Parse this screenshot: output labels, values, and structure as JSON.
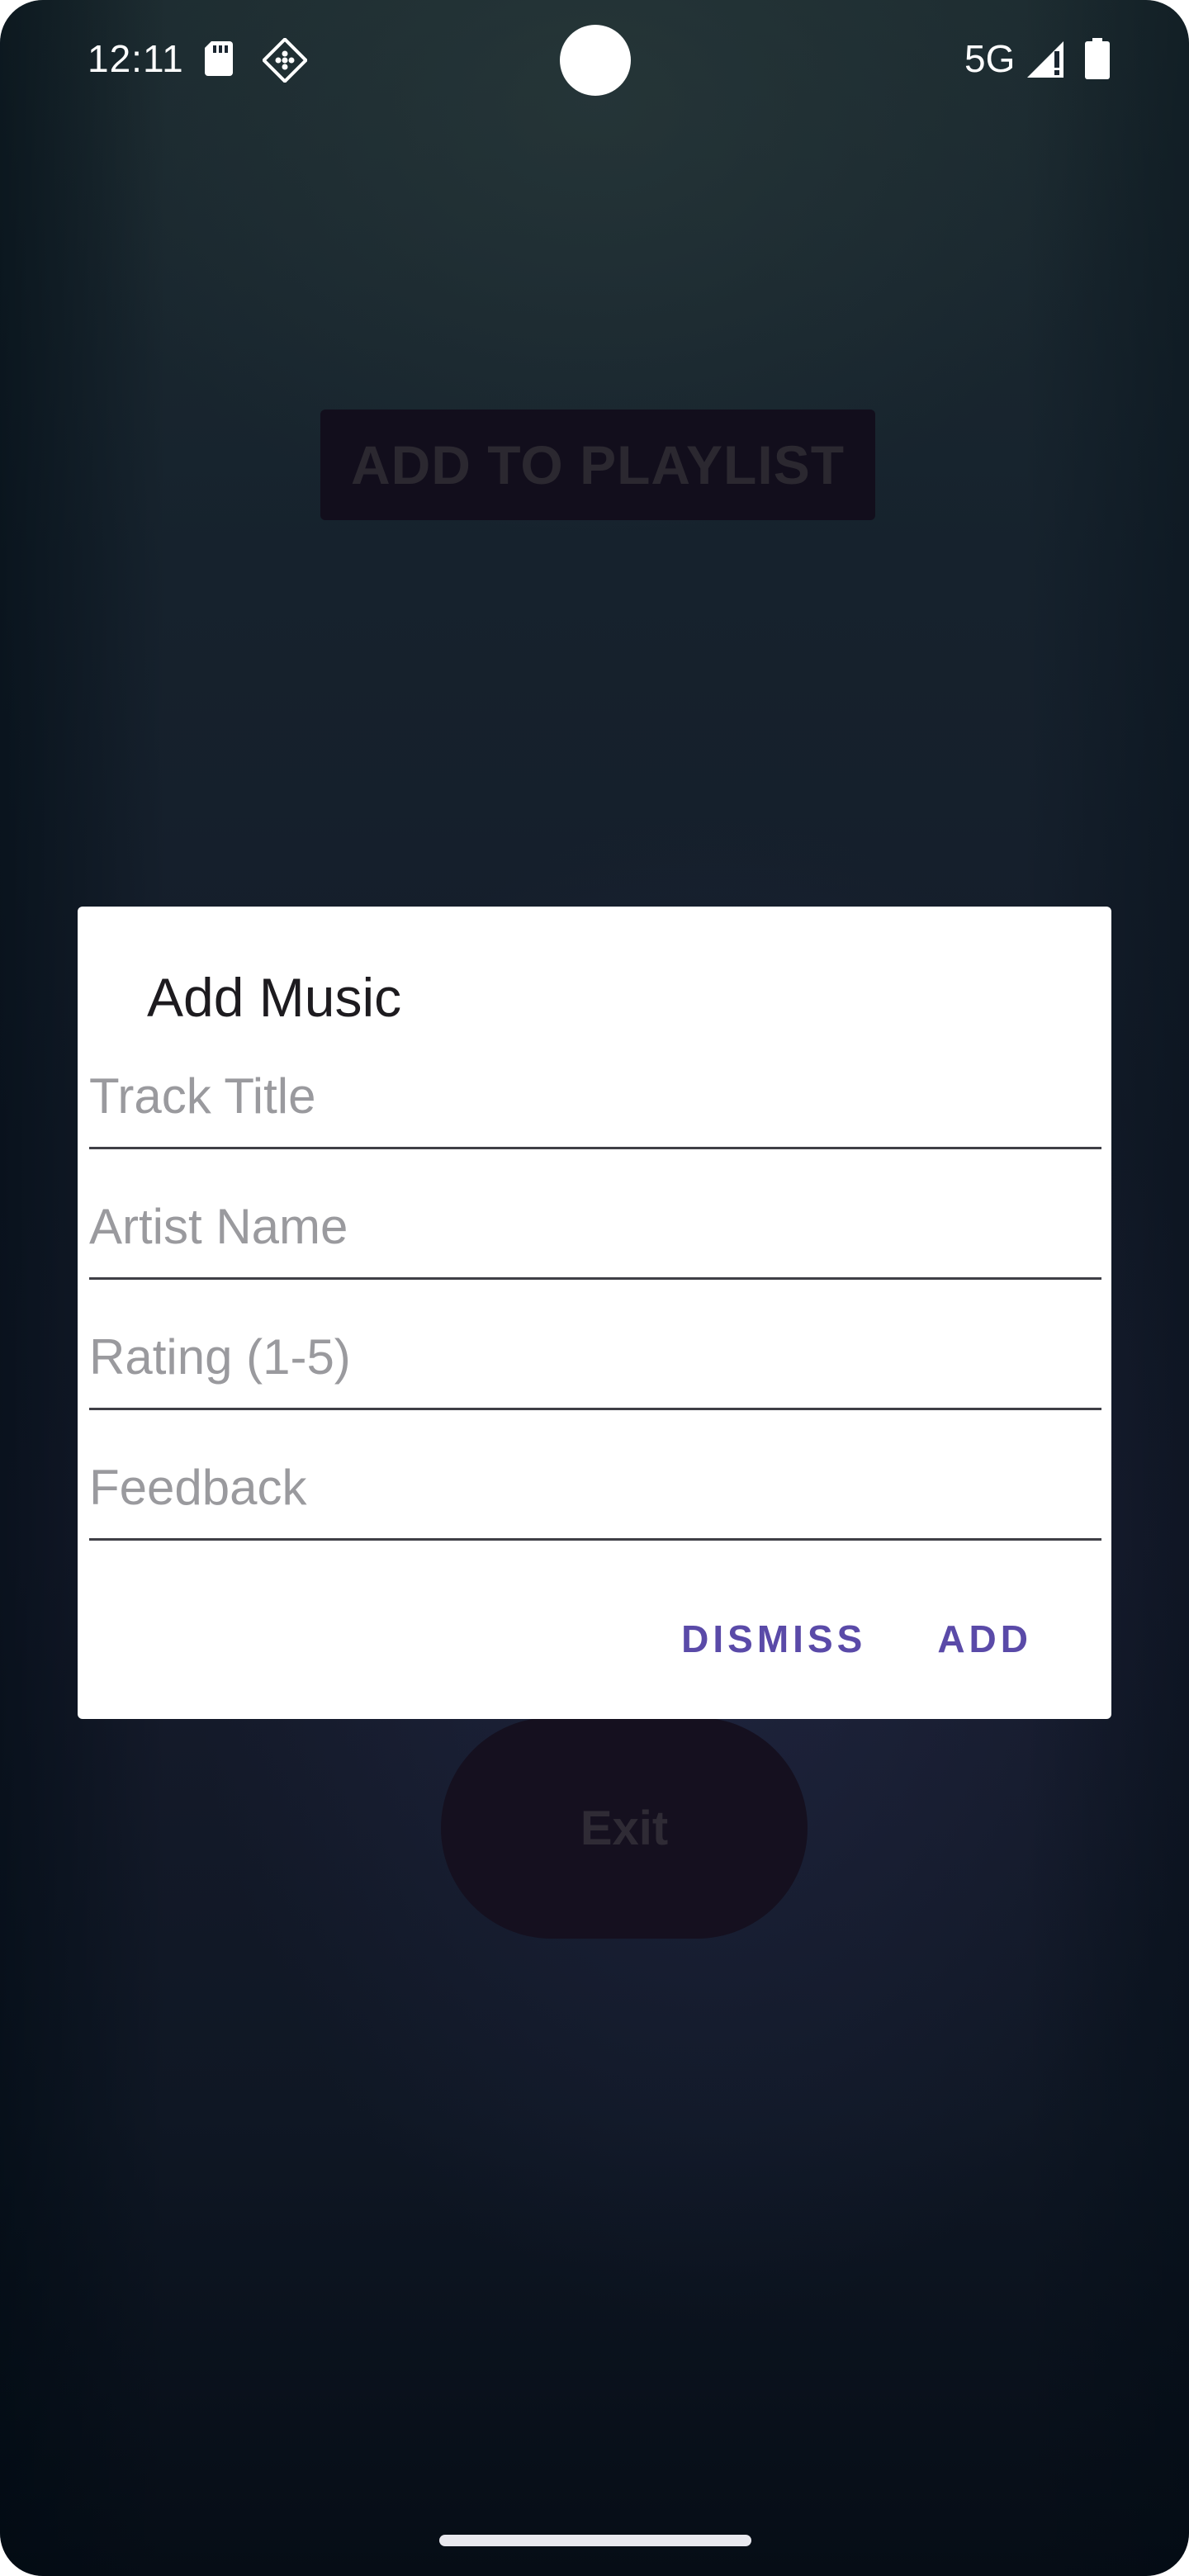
{
  "status_bar": {
    "time": "12:11",
    "network": "5G",
    "icons": [
      "sd-card-icon",
      "diamond-grid-icon",
      "signal-icon",
      "battery-icon"
    ]
  },
  "background": {
    "playlist_button": "ADD TO PLAYLIST",
    "exit_button": "Exit"
  },
  "dialog": {
    "title": "Add Music",
    "fields": {
      "track_title": {
        "placeholder": "Track Title",
        "value": ""
      },
      "artist_name": {
        "placeholder": "Artist Name",
        "value": ""
      },
      "rating": {
        "placeholder": "Rating (1-5)",
        "value": ""
      },
      "feedback": {
        "placeholder": "Feedback",
        "value": ""
      }
    },
    "dismiss": "DISMISS",
    "add": "ADD"
  },
  "colors": {
    "accent": "#5a4aa8",
    "dialog_bg": "#ffffff",
    "screen_bg": "#141c2a"
  }
}
